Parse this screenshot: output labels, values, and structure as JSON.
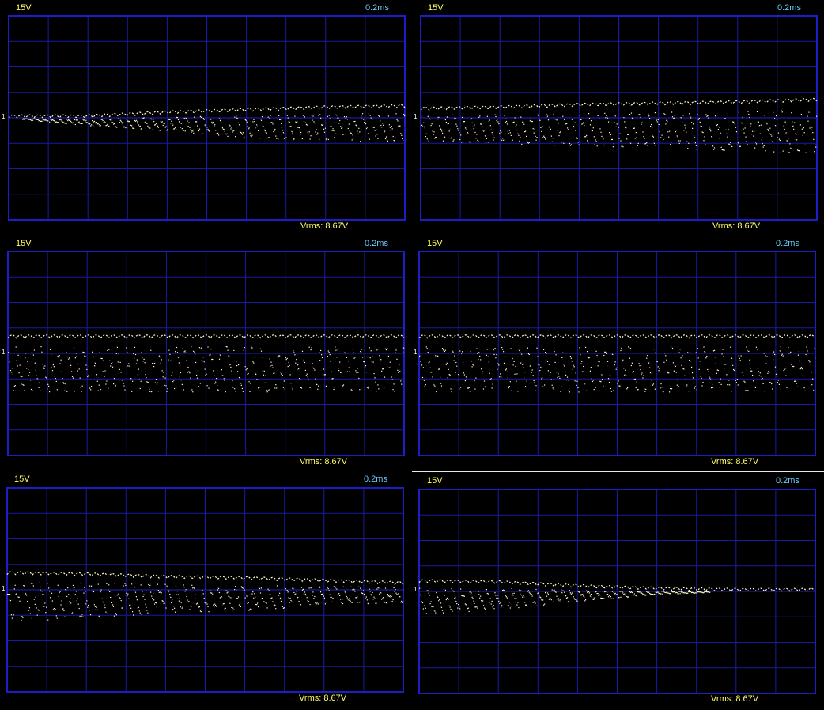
{
  "colors": {
    "background": "#000000",
    "grid": "#1a1aa0",
    "frame": "#1e1ec8",
    "trace": "#ffffcc",
    "volts_text": "#ffff66",
    "time_text": "#66ccff"
  },
  "panels": [
    {
      "volts_label": "15V",
      "time_label": "0.2ms",
      "marker": "1",
      "vrms": "Vrms: 8.67V"
    },
    {
      "volts_label": "15V",
      "time_label": "0.2ms",
      "marker": "1",
      "vrms": "Vrms: 8.67V"
    },
    {
      "volts_label": "15V",
      "time_label": "0.2ms",
      "marker": "1",
      "vrms": "Vrms: 8.67V"
    },
    {
      "volts_label": "15V",
      "time_label": "0.2ms",
      "marker": "1",
      "vrms": "Vrms: 8.67V"
    },
    {
      "volts_label": "15V",
      "time_label": "0.2ms",
      "marker": "1",
      "vrms": "Vrms: 8.67V"
    },
    {
      "volts_label": "15V",
      "time_label": "0.2ms",
      "marker": "1",
      "vrms": "Vrms: 8.67V"
    }
  ],
  "chart_data": [
    {
      "type": "line",
      "x_divisions": 10,
      "y_divisions": 8,
      "xlim": [
        0,
        10
      ],
      "ylim": [
        -4,
        4
      ],
      "series": [
        {
          "values": {
            "x": [
              0,
              2,
              4,
              6,
              8,
              10
            ],
            "top_div": [
              0.0,
              0.0,
              0.15,
              0.25,
              0.35,
              0.4
            ],
            "bottom_div": [
              0.0,
              -0.3,
              -0.5,
              -0.8,
              -0.9,
              -0.9
            ]
          }
        }
      ]
    },
    {
      "type": "line",
      "x_divisions": 10,
      "y_divisions": 8,
      "xlim": [
        0,
        10
      ],
      "ylim": [
        -4,
        4
      ],
      "series": [
        {
          "values": {
            "x": [
              0,
              2,
              4,
              6,
              8,
              10
            ],
            "top_div": [
              0.3,
              0.35,
              0.45,
              0.5,
              0.55,
              0.65
            ],
            "bottom_div": [
              -0.9,
              -1.0,
              -1.1,
              -1.2,
              -1.3,
              -1.4
            ]
          }
        }
      ]
    },
    {
      "type": "line",
      "x_divisions": 10,
      "y_divisions": 8,
      "xlim": [
        0,
        10
      ],
      "ylim": [
        -4,
        4
      ],
      "series": [
        {
          "values": {
            "x": [
              0,
              2,
              4,
              6,
              8,
              10
            ],
            "top_div": [
              0.6,
              0.6,
              0.6,
              0.6,
              0.6,
              0.6
            ],
            "bottom_div": [
              -1.5,
              -1.5,
              -1.5,
              -1.5,
              -1.5,
              -1.5
            ]
          }
        }
      ]
    },
    {
      "type": "line",
      "x_divisions": 10,
      "y_divisions": 8,
      "xlim": [
        0,
        10
      ],
      "ylim": [
        -4,
        4
      ],
      "series": [
        {
          "values": {
            "x": [
              0,
              2,
              4,
              6,
              8,
              10
            ],
            "top_div": [
              0.6,
              0.6,
              0.6,
              0.6,
              0.6,
              0.6
            ],
            "bottom_div": [
              -1.5,
              -1.5,
              -1.5,
              -1.5,
              -1.5,
              -1.5
            ]
          }
        }
      ]
    },
    {
      "type": "line",
      "x_divisions": 10,
      "y_divisions": 8,
      "xlim": [
        0,
        10
      ],
      "ylim": [
        -4,
        4
      ],
      "series": [
        {
          "values": {
            "x": [
              0,
              2,
              4,
              6,
              8,
              10
            ],
            "top_div": [
              0.6,
              0.55,
              0.45,
              0.4,
              0.3,
              0.2
            ],
            "bottom_div": [
              -1.3,
              -1.1,
              -0.9,
              -0.8,
              -0.6,
              -0.5
            ]
          }
        }
      ]
    },
    {
      "type": "line",
      "x_divisions": 10,
      "y_divisions": 8,
      "xlim": [
        0,
        10
      ],
      "ylim": [
        -4,
        4
      ],
      "series": [
        {
          "values": {
            "x": [
              0,
              2,
              4,
              6,
              8,
              10
            ],
            "top_div": [
              0.35,
              0.3,
              0.15,
              0.05,
              0.0,
              0.0
            ],
            "bottom_div": [
              -0.9,
              -0.7,
              -0.4,
              -0.1,
              0.0,
              0.0
            ]
          }
        }
      ]
    }
  ]
}
